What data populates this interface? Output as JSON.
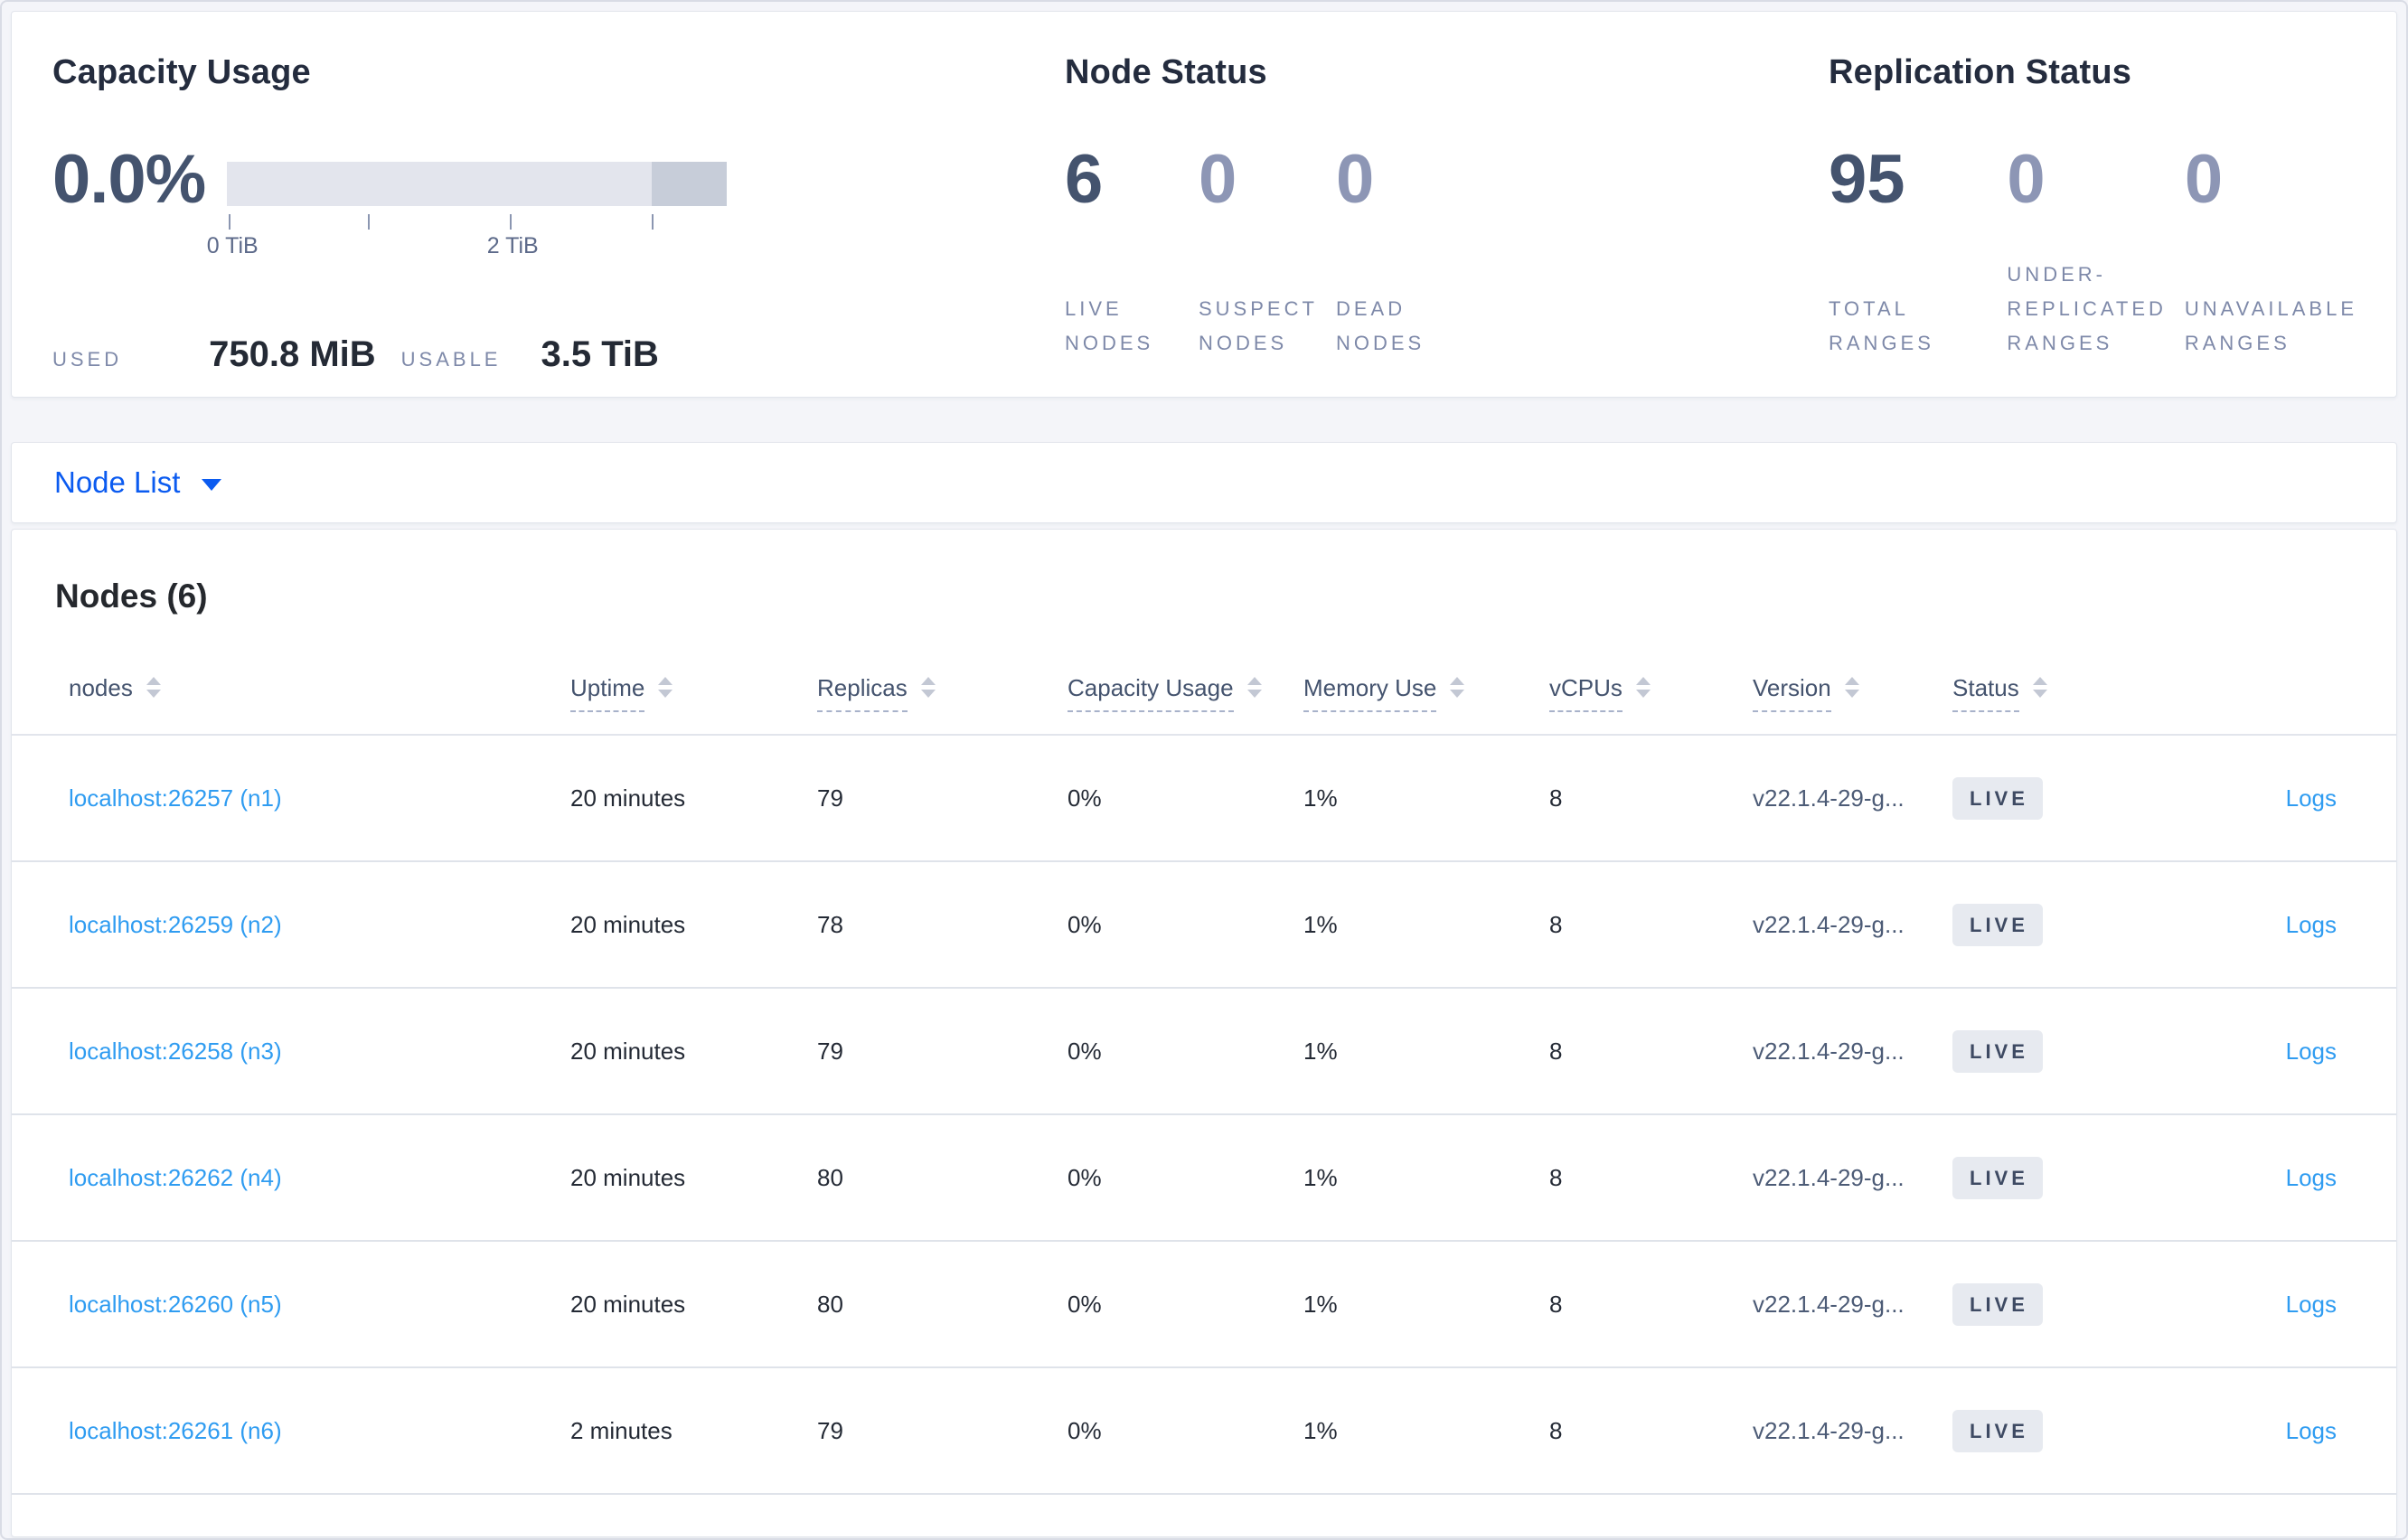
{
  "colors": {
    "page_background": "#f4f5f9",
    "panel_background": "#ffffff",
    "accent_blue": "#0b5bf0",
    "link_blue": "#2f9cf1",
    "stat_number_dark": "#44536e",
    "stat_number_dim": "#8d96b5",
    "stat_label": "#7e89a9",
    "badge_background": "#e7eaf0",
    "badge_text": "#3e4a63",
    "bar_track": "#e3e5ed",
    "bar_dark_segment": "#c7cdd9"
  },
  "capacity": {
    "title": "Capacity Usage",
    "percent": "0.0%",
    "tick_labels": [
      "0 TiB",
      "2 TiB"
    ],
    "used_label": "USED",
    "used_value": "750.8 MiB",
    "usable_label": "USABLE",
    "usable_value": "3.5 TiB"
  },
  "node_status": {
    "title": "Node Status",
    "stats": [
      {
        "value": "6",
        "label": "LIVE NODES",
        "dim": false
      },
      {
        "value": "0",
        "label": "SUSPECT NODES",
        "dim": true
      },
      {
        "value": "0",
        "label": "DEAD NODES",
        "dim": true
      }
    ]
  },
  "replication_status": {
    "title": "Replication Status",
    "stats": [
      {
        "value": "95",
        "label": "TOTAL RANGES",
        "dim": false
      },
      {
        "value": "0",
        "label": "UNDER-REPLICATED RANGES",
        "dim": true
      },
      {
        "value": "0",
        "label": "UNAVAILABLE RANGES",
        "dim": true
      }
    ]
  },
  "node_list": {
    "label": "Node List"
  },
  "nodes_table": {
    "heading": "Nodes (6)",
    "columns": [
      {
        "label": "nodes",
        "underlined": false
      },
      {
        "label": "Uptime",
        "underlined": true
      },
      {
        "label": "Replicas",
        "underlined": true
      },
      {
        "label": "Capacity Usage",
        "underlined": true
      },
      {
        "label": "Memory Use",
        "underlined": true
      },
      {
        "label": "vCPUs",
        "underlined": true
      },
      {
        "label": "Version",
        "underlined": true
      },
      {
        "label": "Status",
        "underlined": true
      }
    ],
    "rows": [
      {
        "name": "localhost:26257 (n1)",
        "uptime": "20 minutes",
        "replicas": "79",
        "capacity": "0%",
        "memory": "1%",
        "vcpus": "8",
        "version": "v22.1.4-29-g...",
        "status": "LIVE",
        "logs": "Logs"
      },
      {
        "name": "localhost:26259 (n2)",
        "uptime": "20 minutes",
        "replicas": "78",
        "capacity": "0%",
        "memory": "1%",
        "vcpus": "8",
        "version": "v22.1.4-29-g...",
        "status": "LIVE",
        "logs": "Logs"
      },
      {
        "name": "localhost:26258 (n3)",
        "uptime": "20 minutes",
        "replicas": "79",
        "capacity": "0%",
        "memory": "1%",
        "vcpus": "8",
        "version": "v22.1.4-29-g...",
        "status": "LIVE",
        "logs": "Logs"
      },
      {
        "name": "localhost:26262 (n4)",
        "uptime": "20 minutes",
        "replicas": "80",
        "capacity": "0%",
        "memory": "1%",
        "vcpus": "8",
        "version": "v22.1.4-29-g...",
        "status": "LIVE",
        "logs": "Logs"
      },
      {
        "name": "localhost:26260 (n5)",
        "uptime": "20 minutes",
        "replicas": "80",
        "capacity": "0%",
        "memory": "1%",
        "vcpus": "8",
        "version": "v22.1.4-29-g...",
        "status": "LIVE",
        "logs": "Logs"
      },
      {
        "name": "localhost:26261 (n6)",
        "uptime": "2 minutes",
        "replicas": "79",
        "capacity": "0%",
        "memory": "1%",
        "vcpus": "8",
        "version": "v22.1.4-29-g...",
        "status": "LIVE",
        "logs": "Logs"
      }
    ]
  }
}
